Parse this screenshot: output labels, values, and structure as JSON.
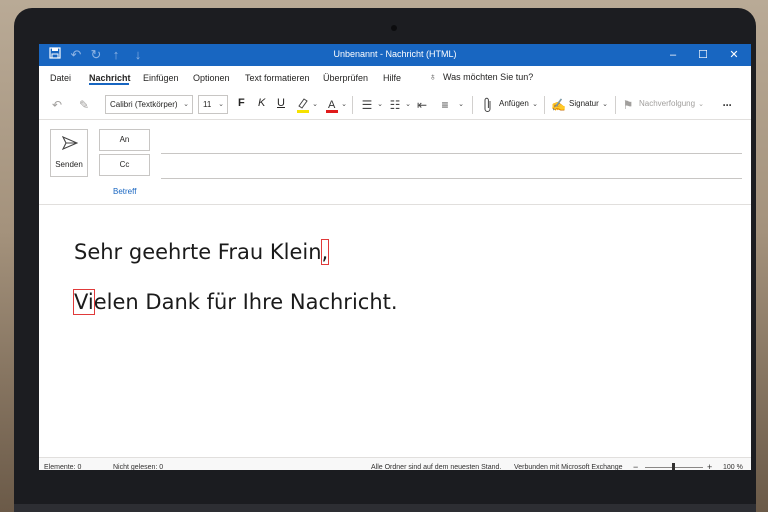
{
  "titlebar": {
    "title": "Unbenannt  -  Nachricht (HTML)",
    "icons": [
      "save-icon",
      "undo-icon",
      "redo-icon",
      "arrow-up-icon",
      "arrow-down-icon"
    ],
    "buttons": [
      "minimize-icon",
      "maximize-icon",
      "close-icon"
    ]
  },
  "menu": {
    "items": [
      "Datei",
      "Nachricht",
      "Einfügen",
      "Optionen",
      "Text formatieren",
      "Überprüfen",
      "Hilfe"
    ],
    "active": "Nachricht",
    "tellme": "Was möchten Sie tun?"
  },
  "ribbon": {
    "font": "Calibri (Textkörper)",
    "size": "11",
    "bold": "F",
    "italic": "K",
    "underline": "U",
    "attach": "Anfügen",
    "signature": "Signatur",
    "followup": "Nachverfolgung",
    "more": "···",
    "colors": {
      "highlight": "#f6e200",
      "font_color": "#e01b1b"
    }
  },
  "compose": {
    "send": "Senden",
    "to": "An",
    "cc": "Cc",
    "subject": "Betreff"
  },
  "body": {
    "greeting": "Sehr geehrte Frau Klein",
    "greeting_punct": ",",
    "line2_first": "Vi",
    "line2_rest": "elen Dank für Ihre Nachricht."
  },
  "status": {
    "elements": "Elemente: 0",
    "unread": "Nicht gelesen: 0",
    "folders": "Alle Ordner sind auf dem neuesten Stand.",
    "connection": "Verbunden mit Microsoft Exchange",
    "zoom": "100 %"
  },
  "colors": {
    "accent": "#1866c1",
    "annotation": "#e03a3a"
  }
}
